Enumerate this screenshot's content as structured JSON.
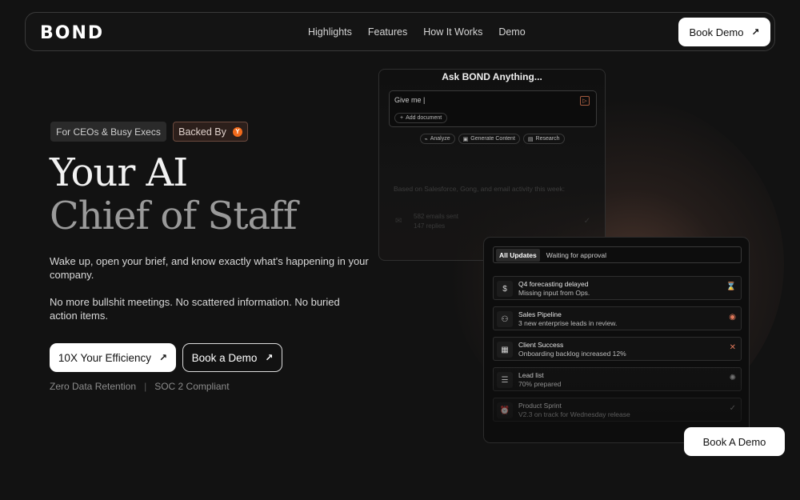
{
  "nav": {
    "logo": "BOND",
    "links": [
      "Highlights",
      "Features",
      "How It Works",
      "Demo"
    ],
    "cta": "Book Demo"
  },
  "hero": {
    "tag1": "For CEOs & Busy Execs",
    "tag2": "Backed By",
    "tag2_badge": "Y",
    "title_line1": "Your AI",
    "title_line2": "Chief of Staff",
    "para1": "Wake up, open your brief, and know exactly what's happening in your company.",
    "para2": "No more bullshit meetings. No scattered information. No buried action items.",
    "cta_primary": "10X Your Efficiency",
    "cta_secondary": "Book a Demo",
    "compliance": [
      "Zero Data Retention",
      "SOC 2 Compliant"
    ]
  },
  "ask_panel": {
    "title": "Ask BOND Anything...",
    "input_value": "Give me |",
    "add_document": "Add document",
    "chips": [
      {
        "icon": "chart-icon",
        "label": "Analyze"
      },
      {
        "icon": "image-icon",
        "label": "Generate Content"
      },
      {
        "icon": "document-icon",
        "label": "Research"
      }
    ],
    "faint_heading": "Based on Salesforce, Gong, and email activity this week:",
    "faint_row": {
      "line1": "582 emails sent",
      "line2": "147 replies"
    }
  },
  "updates": {
    "tabs": [
      "All Updates",
      "Waiting for approval"
    ],
    "active_tab": "All Updates",
    "rows": [
      {
        "icon": "dollar-icon",
        "title": "Q4 forecasting delayed",
        "subtitle": "Missing input from Ops.",
        "status_icon": "hourglass-icon"
      },
      {
        "icon": "users-icon",
        "title": "Sales Pipeline",
        "subtitle": "3 new enterprise leads in review.",
        "status_icon": "eye-icon"
      },
      {
        "icon": "calendar-icon",
        "title": "Client Success",
        "subtitle": "Onboarding backlog increased 12%",
        "status_icon": "x-icon"
      },
      {
        "icon": "list-icon",
        "title": "Lead list",
        "subtitle": "70% prepared",
        "status_icon": "spinner-icon"
      },
      {
        "icon": "alarm-icon",
        "title": "Product Sprint",
        "subtitle": "V2.3 on track for Wednesday release",
        "status_icon": "check-icon"
      }
    ],
    "accent_color": "#e0785a"
  },
  "floating_cta": "Book A Demo"
}
